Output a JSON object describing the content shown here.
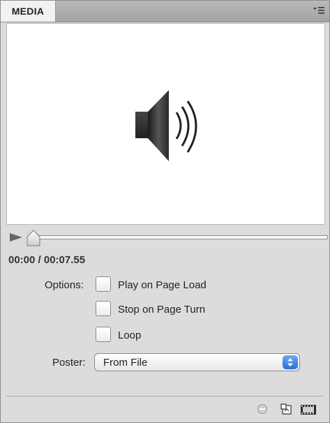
{
  "panel": {
    "tab_title": "MEDIA"
  },
  "icons": {
    "menu": "panel-menu-icon",
    "speaker": "speaker-icon",
    "play": "play-icon",
    "scrubber": "scrubber-thumb-icon",
    "clear": "clear-icon",
    "poster_from_page": "poster-icon",
    "video_settings": "video-strip-icon"
  },
  "transport": {
    "time": "00:00 / 00:07.55",
    "progress_fraction": 0.0
  },
  "options": {
    "label": "Options:",
    "checkboxes": [
      {
        "label": "Play on Page Load",
        "checked": false
      },
      {
        "label": "Stop on Page Turn",
        "checked": false
      },
      {
        "label": "Loop",
        "checked": false
      }
    ]
  },
  "poster": {
    "label": "Poster:",
    "selected": "From File"
  },
  "colors": {
    "accent": "#2d6fd8",
    "panel_bg": "#dcdcdc",
    "preview_bg": "#ffffff"
  }
}
